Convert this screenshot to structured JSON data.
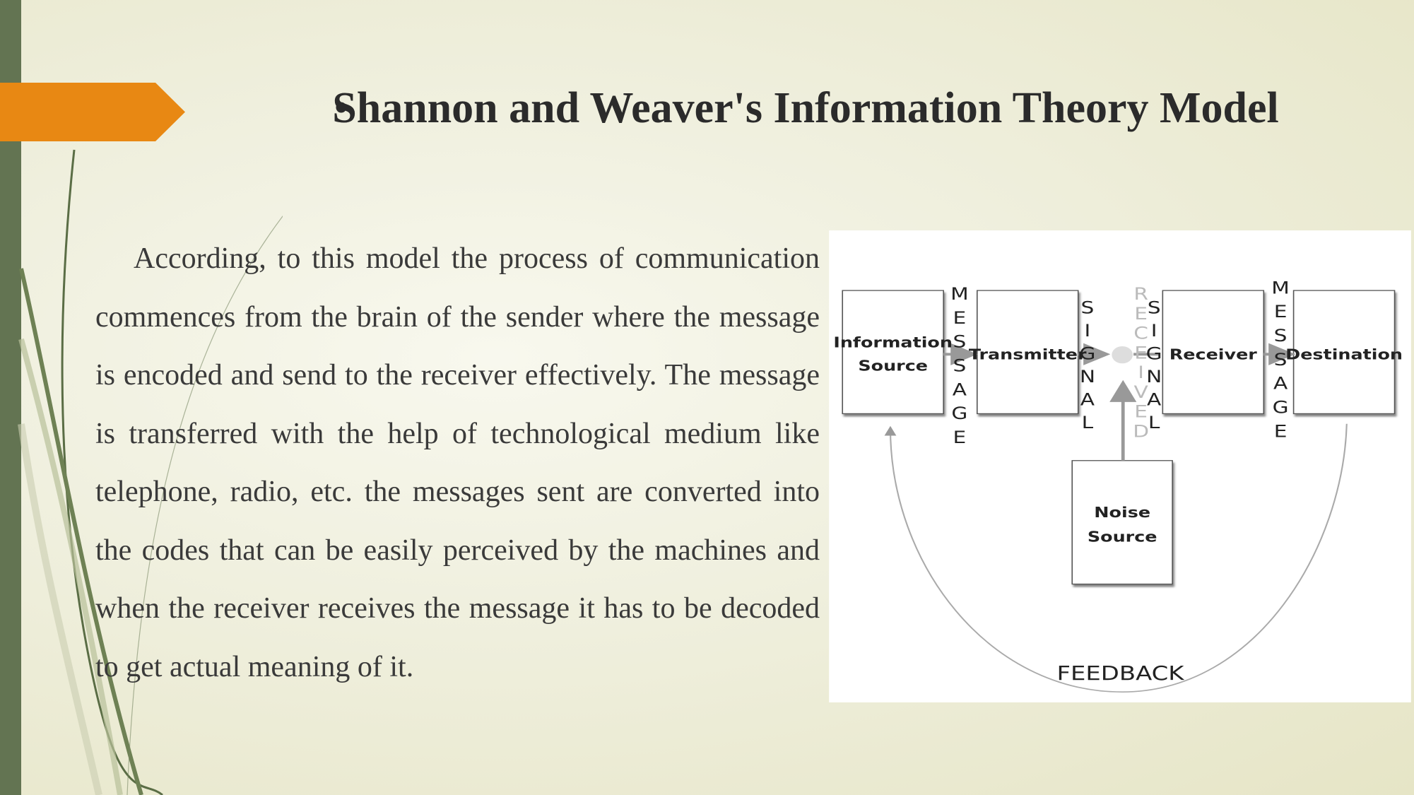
{
  "slide": {
    "bullet": "•",
    "title": "Shannon and Weaver's Information Theory Model",
    "paragraph": "According, to this model the process of communication commences from the brain of the sender where the message is encoded and send to the receiver effectively. The message is transferred with the help of technological medium like telephone, radio, etc. the messages sent are converted into the codes that can be easily perceived by the machines and when the receiver receives the message it has to be decoded to get actual meaning of it.",
    "colors": {
      "accent_arrow": "#e88813",
      "side_bar": "#637452"
    }
  },
  "diagram": {
    "boxes": {
      "info_source": [
        "Information",
        "Source"
      ],
      "transmitter": "Transmitter",
      "receiver": "Receiver",
      "destination": "Destination",
      "noise_source": [
        "Noise",
        "Source"
      ]
    },
    "labels": {
      "message1": "MESSAGE",
      "signal1": "SIGNAL",
      "received": "RECEIVED",
      "signal2": "SIGNAL",
      "message2": "MESSAGE",
      "feedback": "FEEDBACK"
    }
  }
}
